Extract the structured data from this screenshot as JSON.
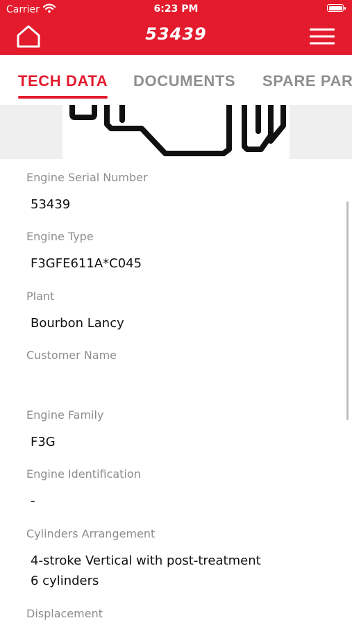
{
  "status_bar": {
    "carrier": "Carrier",
    "time": "6:23 PM"
  },
  "header": {
    "title": "53439",
    "home_icon": "home-icon",
    "menu_icon": "hamburger-menu-icon",
    "background_color": "#e31b2d"
  },
  "tabs": [
    {
      "label": "TECH DATA",
      "active": true
    },
    {
      "label": "DOCUMENTS",
      "active": false
    },
    {
      "label": "SPARE PARTS",
      "active": false
    }
  ],
  "fields": [
    {
      "label": "Engine Serial Number",
      "value": "53439"
    },
    {
      "label": "Engine Type",
      "value": "F3GFE611A*C045"
    },
    {
      "label": "Plant",
      "value": "Bourbon Lancy"
    },
    {
      "label": "Customer Name",
      "value": ""
    },
    {
      "label": "Engine Family",
      "value": "F3G"
    },
    {
      "label": "Engine Identification",
      "value": "-"
    },
    {
      "label": "Cylinders Arrangement",
      "value": "4-stroke Vertical with post-treatment",
      "value_line2": "6 cylinders"
    },
    {
      "label": "Displacement",
      "value": ""
    }
  ],
  "colors": {
    "accent": "#e31b2d",
    "label_gray": "#8d8d8d",
    "tab_inactive": "#8f8f8f"
  }
}
